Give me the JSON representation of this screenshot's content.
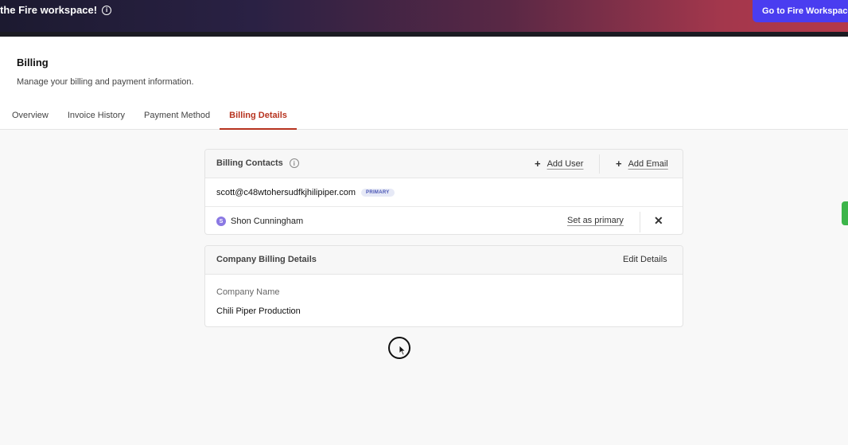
{
  "banner": {
    "text": "the Fire workspace!",
    "info_icon": "info-icon",
    "cta_label": "Go to Fire Workspace"
  },
  "page": {
    "title": "Billing",
    "subtitle": "Manage your billing and payment information."
  },
  "tabs": [
    {
      "label": "Overview",
      "active": false
    },
    {
      "label": "Invoice History",
      "active": false
    },
    {
      "label": "Payment Method",
      "active": false
    },
    {
      "label": "Billing Details",
      "active": true
    }
  ],
  "billing_contacts": {
    "title": "Billing Contacts",
    "add_user_label": "Add User",
    "add_email_label": "Add Email",
    "primary_email": "scott@c48wtohersudfkjhilipiper.com",
    "primary_badge": "PRIMARY",
    "contacts": [
      {
        "initial": "S",
        "name": "Shon Cunningham",
        "action_label": "Set as primary"
      }
    ]
  },
  "company_billing": {
    "title": "Company Billing Details",
    "edit_label": "Edit Details",
    "field_label": "Company Name",
    "field_value": "Chili Piper Production"
  },
  "colors": {
    "active_tab": "#b7331f",
    "cta": "#4a3df0",
    "badge_text": "#4854b4",
    "avatar": "#8a78e3",
    "side_tab": "#3cb54a"
  }
}
